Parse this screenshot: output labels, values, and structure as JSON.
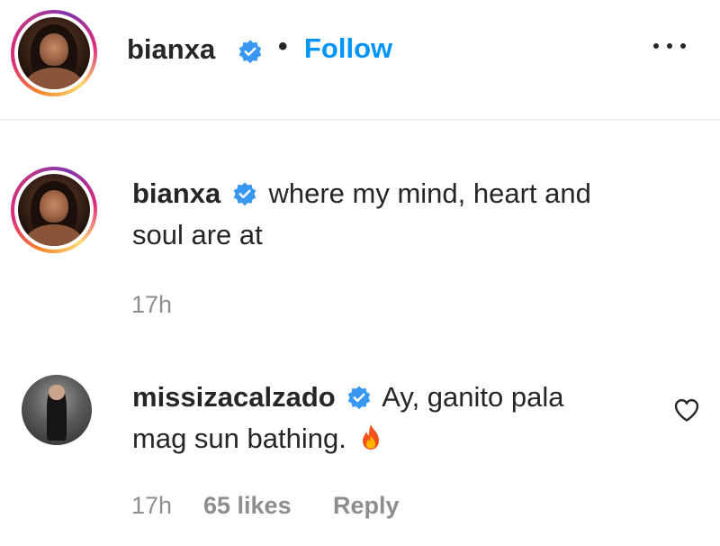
{
  "post": {
    "author": "bianxa",
    "follow_sep": "•",
    "follow_label": "Follow",
    "more_icon": "more-horizontal-icon"
  },
  "caption": {
    "author": "bianxa",
    "text_line1": "where my mind, heart and",
    "text_line2": "soul are at",
    "time": "17h"
  },
  "comment": {
    "author": "missizacalzado",
    "text_line1": "Ay, ganito pala",
    "text_line2": "mag sun bathing.",
    "emoji_icon": "fire-icon",
    "time": "17h",
    "likes": "65 likes",
    "reply_label": "Reply",
    "heart_icon": "heart-outline-icon"
  },
  "colors": {
    "link_blue": "#0095f6",
    "verified_blue": "#3897f0",
    "muted": "#8e8e8e",
    "text": "#262626",
    "divider": "#efefef"
  }
}
